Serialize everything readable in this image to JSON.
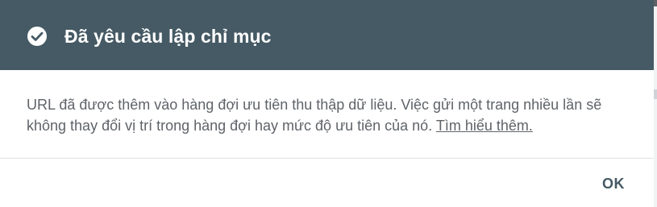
{
  "dialog": {
    "title": "Đã yêu cầu lập chỉ mục",
    "message": "URL đã được thêm vào hàng đợi ưu tiên thu thập dữ liệu. Việc gửi một trang nhiều lần sẽ không thay đổi vị trí trong hàng đợi hay mức độ ưu tiên của nó.",
    "learn_more_link": "Tìm hiểu thêm.",
    "ok_label": "OK",
    "icon": "check-circle-icon"
  },
  "colors": {
    "header_bg": "#455a64",
    "header_text": "#ffffff",
    "body_text": "#5f6368",
    "button_text": "#455a64"
  }
}
